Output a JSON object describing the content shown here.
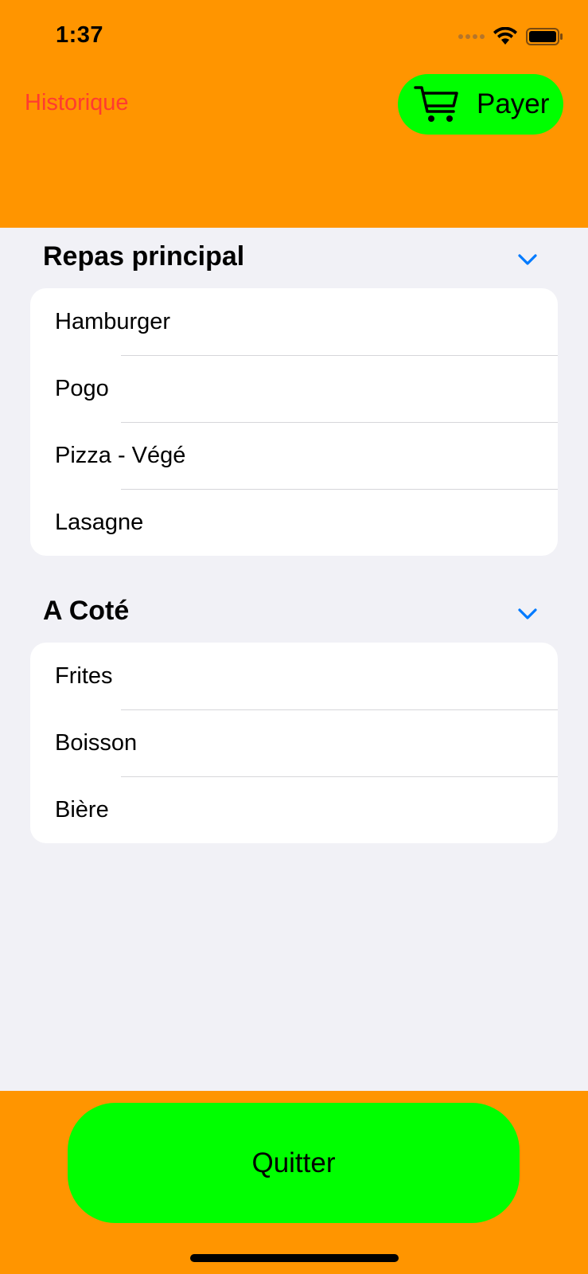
{
  "status_bar": {
    "time": "1:37"
  },
  "header": {
    "history_label": "Historique",
    "pay_label": "Payer",
    "pay_icon": "cart-icon"
  },
  "sections": [
    {
      "title": "Repas principal",
      "items": [
        "Hamburger",
        "Pogo",
        "Pizza - Végé",
        "Lasagne"
      ]
    },
    {
      "title": "A Coté",
      "items": [
        "Frites",
        "Boisson",
        "Bière"
      ]
    }
  ],
  "footer": {
    "quit_label": "Quitter"
  },
  "colors": {
    "header_bg": "#FF9500",
    "accent_green": "#00FF00",
    "link_red": "#FF3B30",
    "chevron_blue": "#007AFF",
    "list_bg": "#F1F1F6"
  }
}
